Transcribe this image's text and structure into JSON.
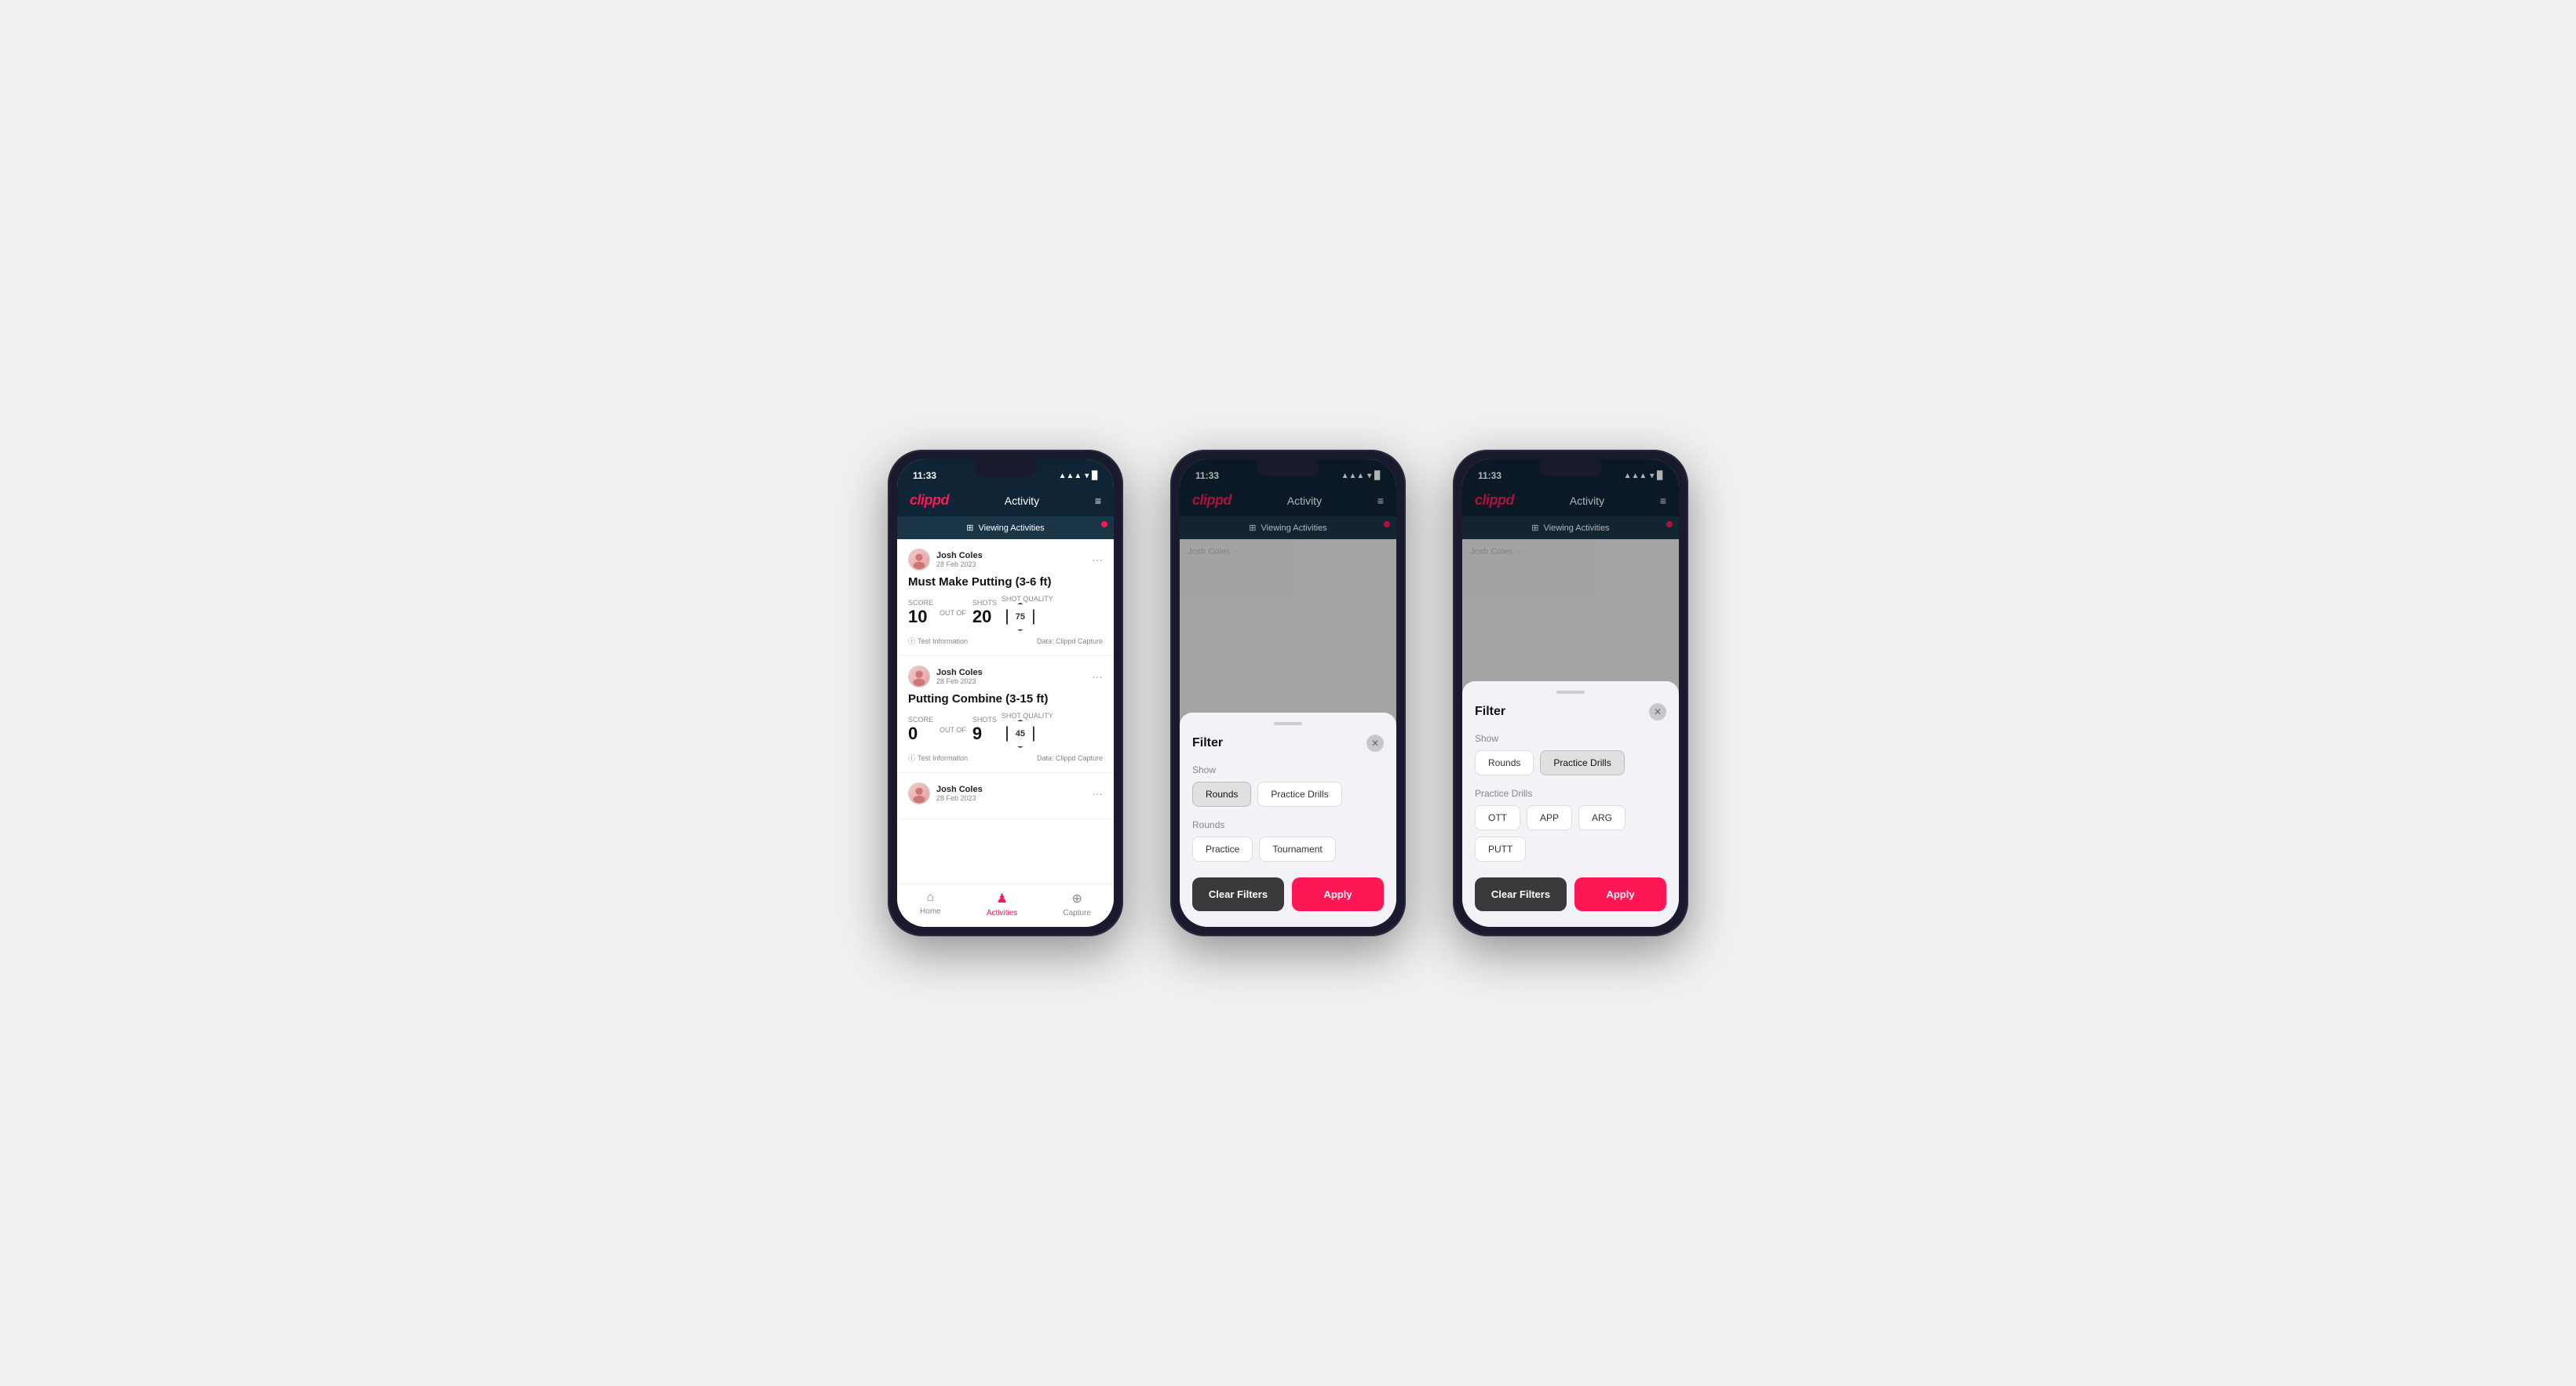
{
  "app": {
    "logo": "clippd",
    "header_title": "Activity",
    "status_time": "11:33",
    "status_icons": "▲ ▾ 🔋"
  },
  "viewing_bar": {
    "text": "Viewing Activities",
    "icon": "⊞"
  },
  "phone1": {
    "activities": [
      {
        "user_name": "Josh Coles",
        "user_date": "28 Feb 2023",
        "title": "Must Make Putting (3-6 ft)",
        "score_label": "Score",
        "score_value": "10",
        "out_of_label": "OUT OF",
        "shots_label": "Shots",
        "shots_value": "20",
        "shot_quality_label": "Shot Quality",
        "shot_quality_value": "75",
        "test_info": "Test Information",
        "data_info": "Data: Clippd Capture"
      },
      {
        "user_name": "Josh Coles",
        "user_date": "28 Feb 2023",
        "title": "Putting Combine (3-15 ft)",
        "score_label": "Score",
        "score_value": "0",
        "out_of_label": "OUT OF",
        "shots_label": "Shots",
        "shots_value": "9",
        "shot_quality_label": "Shot Quality",
        "shot_quality_value": "45",
        "test_info": "Test Information",
        "data_info": "Data: Clippd Capture"
      },
      {
        "user_name": "Josh Coles",
        "user_date": "28 Feb 2023"
      }
    ]
  },
  "nav": {
    "home_label": "Home",
    "activities_label": "Activities",
    "capture_label": "Capture"
  },
  "filter_modal": {
    "title": "Filter",
    "show_label": "Show",
    "rounds_btn": "Rounds",
    "practice_drills_btn": "Practice Drills",
    "rounds_section_label": "Rounds",
    "practice_label": "Practice",
    "tournament_label": "Tournament",
    "clear_filters_label": "Clear Filters",
    "apply_label": "Apply"
  },
  "filter_modal2": {
    "title": "Filter",
    "show_label": "Show",
    "rounds_btn": "Rounds",
    "practice_drills_btn": "Practice Drills",
    "practice_drills_section_label": "Practice Drills",
    "ott_label": "OTT",
    "app_label": "APP",
    "arg_label": "ARG",
    "putt_label": "PUTT",
    "clear_filters_label": "Clear Filters",
    "apply_label": "Apply"
  }
}
